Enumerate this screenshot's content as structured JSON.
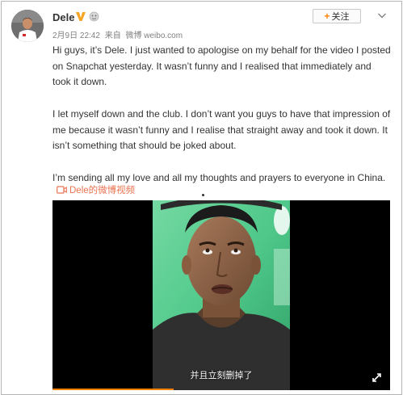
{
  "post": {
    "author": "Dele",
    "meta": {
      "date": "2月9日 22:42",
      "source_prefix": "来自",
      "source": "微博 weibo.com"
    },
    "follow_label": "关注",
    "paragraphs": [
      "Hi guys, it’s Dele. I just wanted to apologise on my behalf for the video I posted on Snapchat yesterday. It wasn’t funny and I realised that immediately and took it down.",
      "I let myself down and the club. I don’t want you guys to have that impression of me because it wasn’t funny and I realise that straight away and took it down. It isn’t something that should be joked about.",
      "I’m sending all my love and all my thoughts and prayers to everyone in China."
    ],
    "video_link_label": "Dele的微博视频",
    "video": {
      "subtitle": "并且立刻删掉了",
      "progress": 0.36
    }
  },
  "colors": {
    "accent_orange": "#ff8200",
    "link_orange": "#eb7350",
    "verified_gold": "#f5a623"
  },
  "icons": [
    "avatar",
    "verified-v-icon",
    "member-icon",
    "dropdown-chevron-icon",
    "video-icon",
    "fullscreen-icon"
  ]
}
